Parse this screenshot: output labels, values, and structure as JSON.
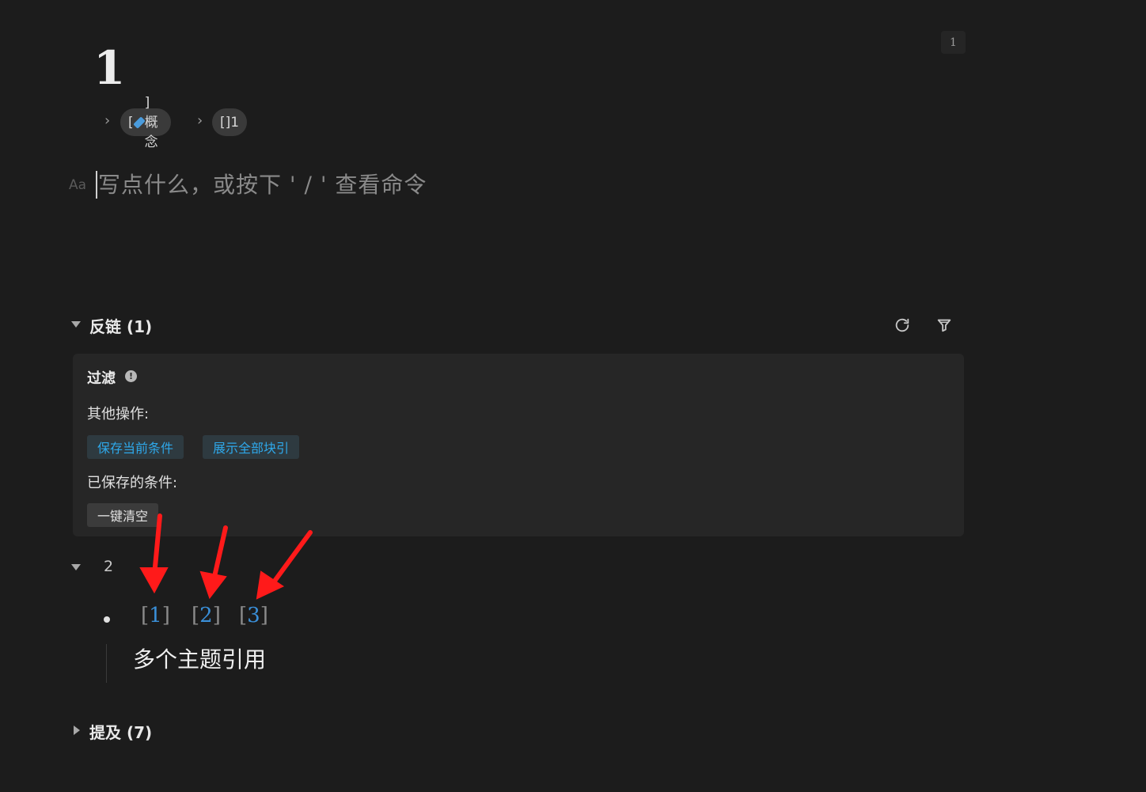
{
  "page": {
    "badge": "1",
    "title": "1"
  },
  "breadcrumb": {
    "items": [
      {
        "prefix": "[",
        "suffix": "]概念"
      },
      {
        "label": "[]1"
      }
    ]
  },
  "editor": {
    "format_hint": "Aa",
    "placeholder": "写点什么，或按下 ' / ' 查看命令"
  },
  "backlinks": {
    "title": "反链 (1)",
    "refresh_icon": "refresh-icon",
    "filter_icon": "filter-icon",
    "filter_panel": {
      "title": "过滤",
      "info_icon": "!",
      "other_ops_label": "其他操作:",
      "buttons": [
        "保存当前条件",
        "展示全部块引"
      ],
      "saved_label": "已保存的条件:",
      "clear_button": "一键清空"
    },
    "node": {
      "label": "2",
      "refs": [
        {
          "open": "[",
          "num": "1",
          "close": "]"
        },
        {
          "open": "[",
          "num": "2",
          "close": "]"
        },
        {
          "open": "[",
          "num": "3",
          "close": "]"
        }
      ],
      "block_text": "多个主题引用"
    }
  },
  "mentions": {
    "title": "提及 (7)"
  },
  "colors": {
    "background": "#1c1c1c",
    "panel": "#262626",
    "link_blue": "#2ea8ea",
    "ref_blue": "#3a8fd8",
    "arrow_red": "#ff1a1a"
  }
}
